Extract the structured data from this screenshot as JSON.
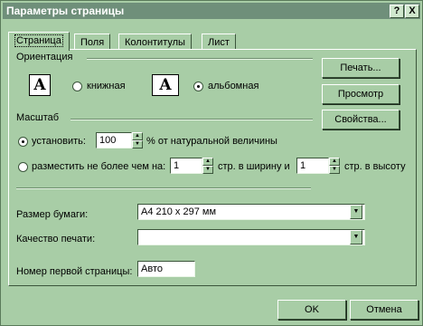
{
  "window": {
    "title": "Параметры страницы",
    "help_glyph": "?",
    "close_glyph": "X"
  },
  "tabs": [
    {
      "label": "Страница"
    },
    {
      "label": "Поля"
    },
    {
      "label": "Колонтитулы"
    },
    {
      "label": "Лист"
    }
  ],
  "orientation": {
    "legend": "Ориентация",
    "portrait_icon": "A",
    "portrait_label": "книжная",
    "landscape_icon": "A",
    "landscape_label": "альбомная",
    "selected": "landscape"
  },
  "scale": {
    "legend": "Масштаб",
    "set_label": "установить:",
    "set_value": "100",
    "set_suffix": "% от натуральной величины",
    "fit_label": "разместить не более чем на:",
    "fit_width_value": "1",
    "fit_width_suffix": "стр. в ширину и",
    "fit_height_value": "1",
    "fit_height_suffix": "стр. в высоту",
    "selected": "set"
  },
  "paper": {
    "size_label": "Размер бумаги:",
    "size_value": "A4 210 x 297 мм",
    "quality_label": "Качество печати:",
    "quality_value": "",
    "first_page_label": "Номер первой страницы:",
    "first_page_value": "Авто"
  },
  "side_buttons": {
    "print": "Печать...",
    "preview": "Просмотр",
    "properties": "Свойства..."
  },
  "footer": {
    "ok": "OK",
    "cancel": "Отмена"
  },
  "icons": {
    "spin_up": "▲",
    "spin_down": "▼",
    "combo_arrow": "▼"
  }
}
